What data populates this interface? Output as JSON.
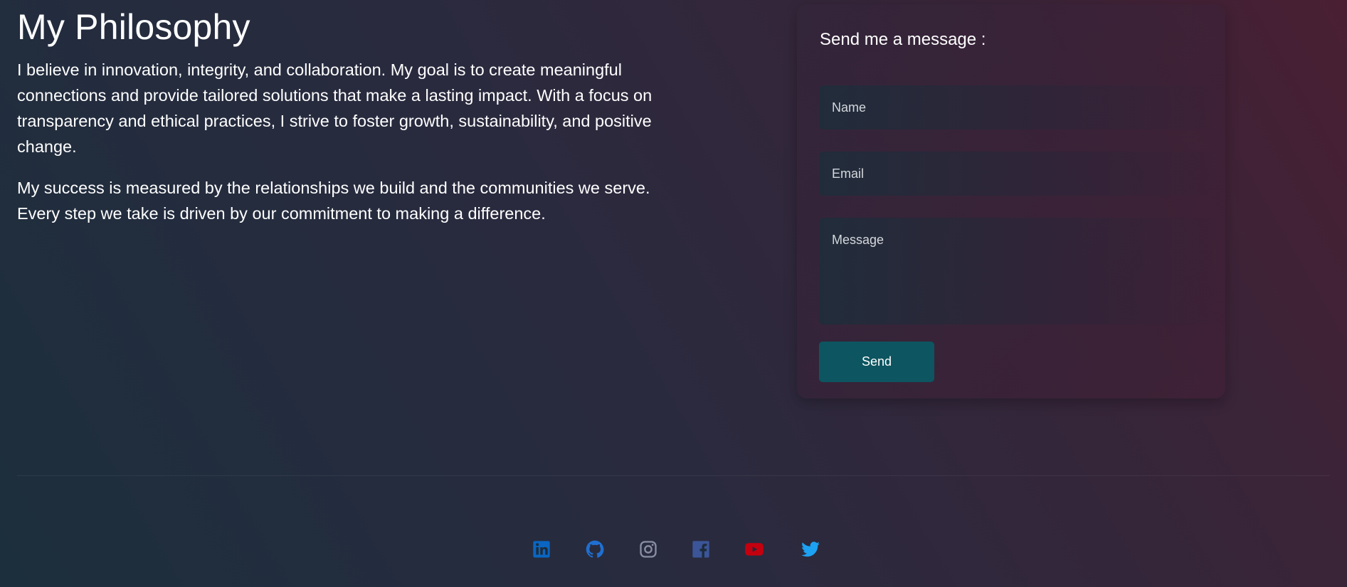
{
  "philosophy": {
    "title": "My Philosophy",
    "paragraph_1": "I believe in innovation, integrity, and collaboration. My goal is to create meaningful connections and provide tailored solutions that make a lasting impact. With a focus on transparency and ethical practices, I strive to foster growth, sustainability, and positive change.",
    "paragraph_2": "My success is measured by the relationships we build and the communities we serve. Every step we take is driven by our commitment to making a difference."
  },
  "contact": {
    "title": "Send me a message :",
    "name_placeholder": "Name",
    "email_placeholder": "Email",
    "message_placeholder": "Message",
    "send_label": "Send"
  },
  "social": [
    {
      "name": "linkedin-icon",
      "color": "#0a66c2"
    },
    {
      "name": "github-icon",
      "color": "#1f6fd1"
    },
    {
      "name": "instagram-icon",
      "color": "#8a8fa3"
    },
    {
      "name": "facebook-icon",
      "color": "#3b5598"
    },
    {
      "name": "youtube-icon",
      "color": "#c4000f"
    },
    {
      "name": "twitter-icon",
      "color": "#1da1f2"
    }
  ],
  "colors": {
    "accent": "#0d5560"
  }
}
